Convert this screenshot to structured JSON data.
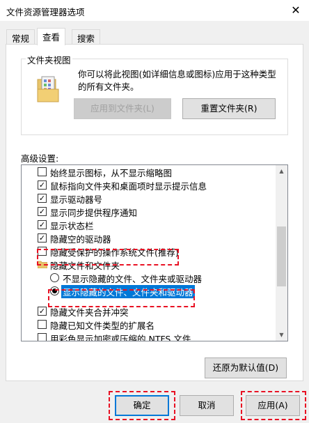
{
  "window": {
    "title": "文件资源管理器选项",
    "close_glyph": "✕"
  },
  "tabs": [
    {
      "label": "常规"
    },
    {
      "label": "查看"
    },
    {
      "label": "搜索"
    }
  ],
  "folder_views": {
    "legend": "文件夹视图",
    "description": "你可以将此视图(如详细信息或图标)应用于这种类型的所有文件夹。",
    "apply_button": "应用到文件夹(L)",
    "reset_button": "重置文件夹(R)"
  },
  "advanced": {
    "label": "高级设置:",
    "items": [
      {
        "text": "始终显示图标，从不显示缩略图",
        "kind": "checkbox",
        "checked": false
      },
      {
        "text": "鼠标指向文件夹和桌面项时显示提示信息",
        "kind": "checkbox",
        "checked": true
      },
      {
        "text": "显示驱动器号",
        "kind": "checkbox",
        "checked": true
      },
      {
        "text": "显示同步提供程序通知",
        "kind": "checkbox",
        "checked": true
      },
      {
        "text": "显示状态栏",
        "kind": "checkbox",
        "checked": true
      },
      {
        "text": "隐藏空的驱动器",
        "kind": "checkbox",
        "checked": true
      },
      {
        "text": "隐藏受保护的操作系统文件(推荐)",
        "kind": "checkbox",
        "checked": false
      },
      {
        "text": "隐藏文件和文件夹",
        "kind": "folder"
      },
      {
        "text": "不显示隐藏的文件、文件夹或驱动器",
        "kind": "radio",
        "checked": false
      },
      {
        "text": "显示隐藏的文件、文件夹和驱动器",
        "kind": "radio",
        "checked": true
      },
      {
        "text": "隐藏文件夹合并冲突",
        "kind": "checkbox",
        "checked": true
      },
      {
        "text": "隐藏已知文件类型的扩展名",
        "kind": "checkbox",
        "checked": false
      },
      {
        "text": "用彩色显示加密或压缩的 NTFS 文件",
        "kind": "checkbox",
        "checked": false
      }
    ],
    "restore_button": "还原为默认值(D)"
  },
  "footer": {
    "ok": "确定",
    "cancel": "取消",
    "apply": "应用(A)"
  },
  "colors": {
    "accent": "#0078d7",
    "annotation": "#e81123"
  }
}
